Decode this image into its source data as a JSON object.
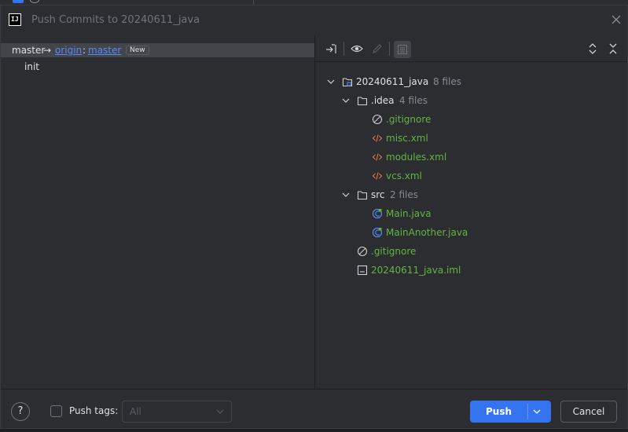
{
  "dialog": {
    "title": "Push Commits to 20240611_java",
    "app_icon_text": "IJ"
  },
  "left": {
    "branch": {
      "local": "master",
      "arrow": "→",
      "remote": "origin",
      "colon": ":",
      "remote_branch": "master",
      "badge": "New"
    },
    "commits": [
      "init"
    ]
  },
  "tree": [
    {
      "name": "20240611_java",
      "count": "8 files",
      "kind": "module",
      "color": "white"
    },
    {
      "name": ".idea",
      "count": "4 files",
      "kind": "folder",
      "color": "white"
    },
    {
      "name": ".gitignore",
      "count": "",
      "kind": "ignore",
      "color": "green"
    },
    {
      "name": "misc.xml",
      "count": "",
      "kind": "xml",
      "color": "green"
    },
    {
      "name": "modules.xml",
      "count": "",
      "kind": "xml",
      "color": "green"
    },
    {
      "name": "vcs.xml",
      "count": "",
      "kind": "xml",
      "color": "green"
    },
    {
      "name": "src",
      "count": "2 files",
      "kind": "folder",
      "color": "white"
    },
    {
      "name": "Main.java",
      "count": "",
      "kind": "java",
      "color": "green"
    },
    {
      "name": "MainAnother.java",
      "count": "",
      "kind": "java",
      "color": "green"
    },
    {
      "name": ".gitignore",
      "count": "",
      "kind": "ignore",
      "color": "green"
    },
    {
      "name": "20240611_java.iml",
      "count": "",
      "kind": "iml",
      "color": "green"
    }
  ],
  "footer": {
    "help": "?",
    "push_tags_label": "Push tags:",
    "tags_select_value": "All",
    "push_label": "Push",
    "cancel_label": "Cancel"
  },
  "colors": {
    "accent": "#3574f0",
    "added_file": "#62b543",
    "link": "#548af7",
    "xml_icon": "#e8754a",
    "java_icon": "#548af7"
  }
}
